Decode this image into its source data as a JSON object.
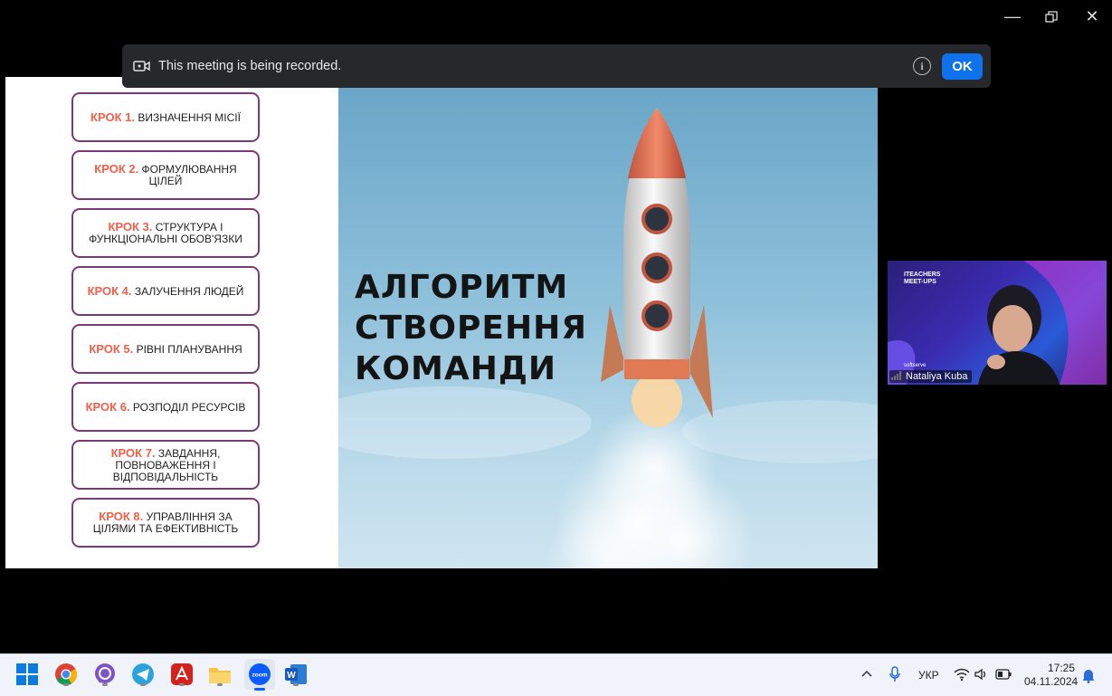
{
  "window": {
    "minimize_icon": "minimize-icon",
    "restore_icon": "restore-icon",
    "close_icon": "close-icon"
  },
  "banner": {
    "text": "This meeting is being recorded.",
    "ok": "OK"
  },
  "slide": {
    "steps": [
      {
        "k": "КРОК 1.",
        "t": " ВИЗНАЧЕННЯ МІСІЇ"
      },
      {
        "k": "КРОК 2.",
        "t": " ФОРМУЛЮВАННЯ ЦІЛЕЙ"
      },
      {
        "k": "КРОК 3.",
        "t": " СТРУКТУРА І ФУНКЦІОНАЛЬНІ ОБОВ'ЯЗКИ"
      },
      {
        "k": "КРОК 4.",
        "t": " ЗАЛУЧЕННЯ ЛЮДЕЙ"
      },
      {
        "k": "КРОК 5.",
        "t": " РІВНІ ПЛАНУВАННЯ"
      },
      {
        "k": "КРОК 6.",
        "t": " РОЗПОДІЛ РЕСУРСІВ"
      },
      {
        "k": "КРОК 7.",
        "t": " ЗАВДАННЯ, ПОВНОВАЖЕННЯ І ВІДПОВІДАЛЬНІСТЬ"
      },
      {
        "k": "КРОК 8.",
        "t": " УПРАВЛІННЯ ЗА ЦІЛЯМИ ТА ЕФЕКТИВНІСТЬ"
      }
    ],
    "title": [
      "АЛГОРИТМ",
      "СТВОРЕННЯ",
      "КОМАНДИ"
    ]
  },
  "participant": {
    "name": "Nataliya Kuba",
    "logo_line1": "ITEACHERS",
    "logo_line2": "MEET-UPS",
    "brand": "softserve"
  },
  "taskbar": {
    "apps": [
      "windows-start-icon",
      "chrome-icon",
      "viber-icon",
      "telegram-icon",
      "acrobat-icon",
      "file-explorer-icon",
      "zoom-icon",
      "word-icon"
    ],
    "lang": "УКР",
    "time": "17:25",
    "date": "04.11.2024"
  }
}
